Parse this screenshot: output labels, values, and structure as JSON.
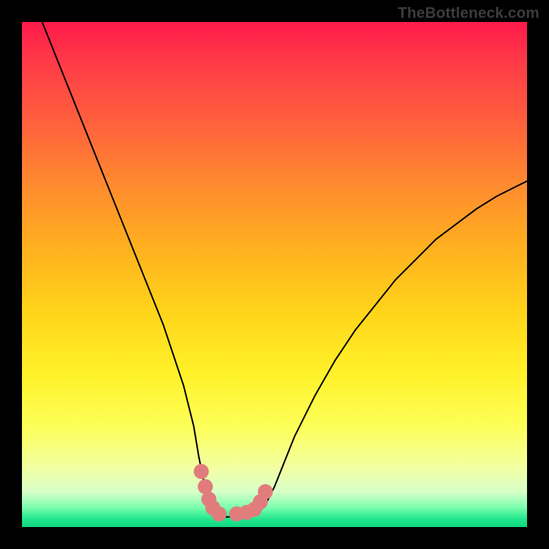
{
  "watermark": "TheBottleneck.com",
  "chart_data": {
    "type": "line",
    "title": "",
    "xlabel": "",
    "ylabel": "",
    "xlim": [
      0,
      100
    ],
    "ylim": [
      0,
      100
    ],
    "grid": false,
    "series": [
      {
        "name": "bottleneck-curve",
        "x": [
          4,
          6,
          8,
          10,
          12,
          14,
          16,
          18,
          20,
          22,
          24,
          26,
          28,
          30,
          32,
          34,
          35,
          36,
          37,
          38,
          39,
          40,
          42,
          44,
          46,
          48,
          50,
          52,
          54,
          58,
          62,
          66,
          70,
          74,
          78,
          82,
          86,
          90,
          94,
          98,
          100
        ],
        "y": [
          100,
          95,
          90,
          85,
          80,
          75,
          70,
          65,
          60,
          55,
          50,
          45,
          40,
          34,
          28,
          20,
          14,
          9,
          5,
          2.5,
          2,
          2,
          2,
          2,
          2.5,
          4,
          8,
          13,
          18,
          26,
          33,
          39,
          44,
          49,
          53,
          57,
          60,
          63,
          65.5,
          67.5,
          68.5
        ],
        "color": "#000000",
        "stroke_width": 2.2
      },
      {
        "name": "bottom-markers",
        "x": [
          35.5,
          36.3,
          37,
          37.8,
          39,
          42.5,
          44.5,
          46,
          47.2,
          48.2
        ],
        "y": [
          11,
          8,
          5.5,
          3.8,
          2.6,
          2.6,
          2.9,
          3.5,
          5,
          7
        ],
        "color": "#e17c7c",
        "marker_size": 11
      }
    ],
    "background": {
      "type": "vertical-gradient",
      "stops": [
        {
          "pos": 0.0,
          "color": "#ff1a4b"
        },
        {
          "pos": 0.45,
          "color": "#ffb11f"
        },
        {
          "pos": 0.8,
          "color": "#fdff58"
        },
        {
          "pos": 0.96,
          "color": "#7fffb0"
        },
        {
          "pos": 1.0,
          "color": "#10d87e"
        }
      ]
    }
  }
}
